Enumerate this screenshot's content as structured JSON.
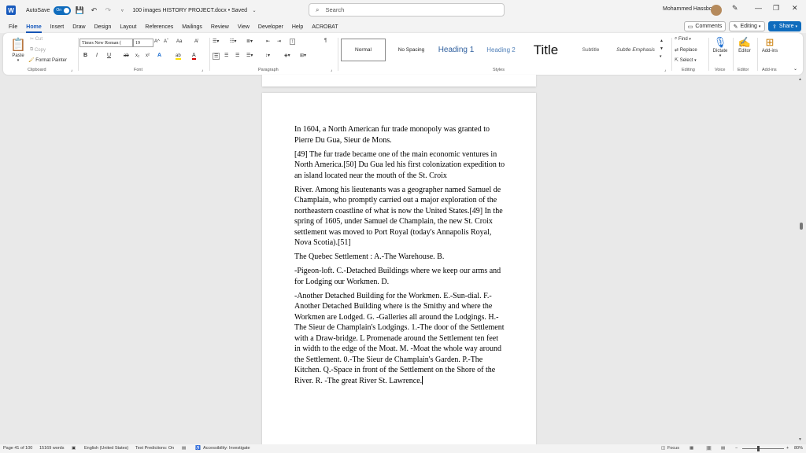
{
  "titlebar": {
    "app_icon_letter": "W",
    "autosave_label": "AutoSave",
    "autosave_state": "On",
    "doc_title": "100 images HISTORY PROJECT.docx • Saved",
    "search_placeholder": "Search",
    "user_name": "Mohammed Hassbo"
  },
  "menu": {
    "tabs": [
      "File",
      "Home",
      "Insert",
      "Draw",
      "Design",
      "Layout",
      "References",
      "Mailings",
      "Review",
      "View",
      "Developer",
      "Help",
      "ACROBAT"
    ],
    "active_tab": "Home",
    "comments_label": "Comments",
    "editing_label": "Editing",
    "share_label": "Share"
  },
  "ribbon": {
    "clipboard": {
      "paste": "Paste",
      "cut": "Cut",
      "copy": "Copy",
      "format_painter": "Format Painter",
      "label": "Clipboard"
    },
    "font": {
      "font_name": "Times New Roman (",
      "font_size": "19",
      "label": "Font",
      "bold": "B",
      "italic": "I",
      "underline": "U",
      "strike": "ab",
      "sub": "x₂",
      "sup": "x²",
      "grow": "A^",
      "shrink": "Aˇ",
      "case": "Aa",
      "effects": "A",
      "highlight": "ab",
      "color": "A"
    },
    "paragraph": {
      "label": "Paragraph"
    },
    "styles": {
      "items": [
        "Normal",
        "No Spacing",
        "Heading 1",
        "Heading 2",
        "Title",
        "Subtitle",
        "Subtle Emphasis"
      ],
      "label": "Styles"
    },
    "editing": {
      "find": "Find",
      "replace": "Replace",
      "select": "Select",
      "label": "Editing"
    },
    "voice": {
      "dictate": "Dictate",
      "label": "Voice"
    },
    "editor": {
      "editor": "Editor",
      "label": "Editor"
    },
    "addins": {
      "addins": "Add-ins",
      "label": "Add-ins"
    }
  },
  "document": {
    "paragraphs": [
      "In 1604, a North American fur trade monopoly was granted to Pierre Du Gua, Sieur de Mons.",
      "[49] The fur trade became one of the main economic ventures in North America.[50] Du Gua led his first colonization expedition to an island located near the mouth of the St. Croix",
      "River. Among his lieutenants was a geographer named Samuel de Champlain, who promptly carried out a major exploration of the northeastern coastline of what is now the United States.[49] In the spring of 1605, under Samuel de Champlain, the new St. Croix settlement was moved to Port Royal (today's Annapolis Royal, Nova Scotia).[51]",
      "The Quebec Settlement : A.-The Warehouse. B.",
      "-Pigeon-loft. C.-Detached Buildings where we keep our arms and for Lodging our Workmen. D.",
      "-Another Detached Building for the Workmen. E.-Sun-dial. F.-Another Detached Building where is the Smithy and where the Workmen are Lodged. G. -Galleries all around the Lodgings. H.-The Sieur de Champlain's Lodgings. 1.-The door of the Settlement with a Draw-bridge. L Promenade around the Settlement ten feet in width to the edge of the Moat. M. -Moat the whole way around the Settlement. 0.-The Sieur de Champlain's Garden. P.-The Kitchen. Q.-Space in front of the Settlement on the Shore of the River. R. -The great River St. Lawrence."
    ]
  },
  "statusbar": {
    "page": "Page 41 of 100",
    "words": "15169 words",
    "language": "English (United States)",
    "predictions": "Text Predictions: On",
    "accessibility": "Accessibility: Investigate",
    "focus": "Focus",
    "zoom": "80%"
  },
  "colors": {
    "accent": "#185abd",
    "share": "#0f6cbd"
  }
}
